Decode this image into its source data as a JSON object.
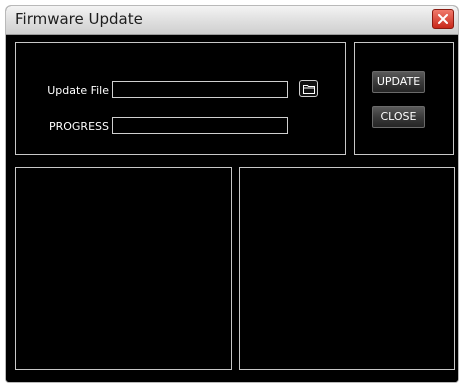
{
  "window": {
    "title": "Firmware Update",
    "close_icon": "close-x-icon"
  },
  "form": {
    "update_file_label": "Update File",
    "update_file_value": "",
    "browse_icon": "folder-open-icon",
    "progress_label": "PROGRESS",
    "progress_value": ""
  },
  "actions": {
    "update_label": "UPDATE",
    "close_label": "CLOSE"
  },
  "colors": {
    "background": "#000000",
    "panel_border": "#c8c8c8",
    "close_button": "#d9352a"
  }
}
